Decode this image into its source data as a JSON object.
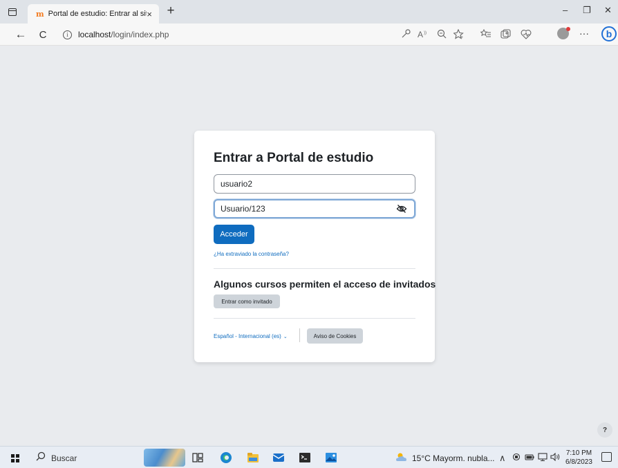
{
  "browser": {
    "tab_title": "Portal de estudio: Entrar al sitio",
    "tab_favicon": "m",
    "tab_close": "×",
    "new_tab": "+",
    "window_controls": {
      "minimize": "–",
      "restore": "❐",
      "close": "✕"
    },
    "nav": {
      "back": "←",
      "refresh": "C"
    },
    "url_host": "localhost",
    "url_path": "/login/index.php",
    "info_symbol": "i",
    "more": "···",
    "bing": "b"
  },
  "login": {
    "title": "Entrar a Portal de estudio",
    "username_value": "usuario2",
    "password_value": "Usuario/123",
    "submit_label": "Acceder",
    "forgot_link": "¿Ha extraviado la contraseña?",
    "guest_heading": "Algunos cursos permiten el acceso de invitados",
    "guest_button": "Entrar como invitado",
    "language": "Español - Internacional (es)",
    "language_chevron": "⌄",
    "cookies_button": "Aviso de Cookies"
  },
  "help_button": "?",
  "taskbar": {
    "search_label": "Buscar",
    "weather": "15°C  Mayorm. nubla...",
    "time": "7:10 PM",
    "date": "6/8/2023",
    "tray_chevron": "∧"
  },
  "colors": {
    "primary": "#0f6cbf",
    "page_background": "#e9ebee",
    "secondary_button": "#ced4da",
    "favicon": "#f37a1f"
  }
}
